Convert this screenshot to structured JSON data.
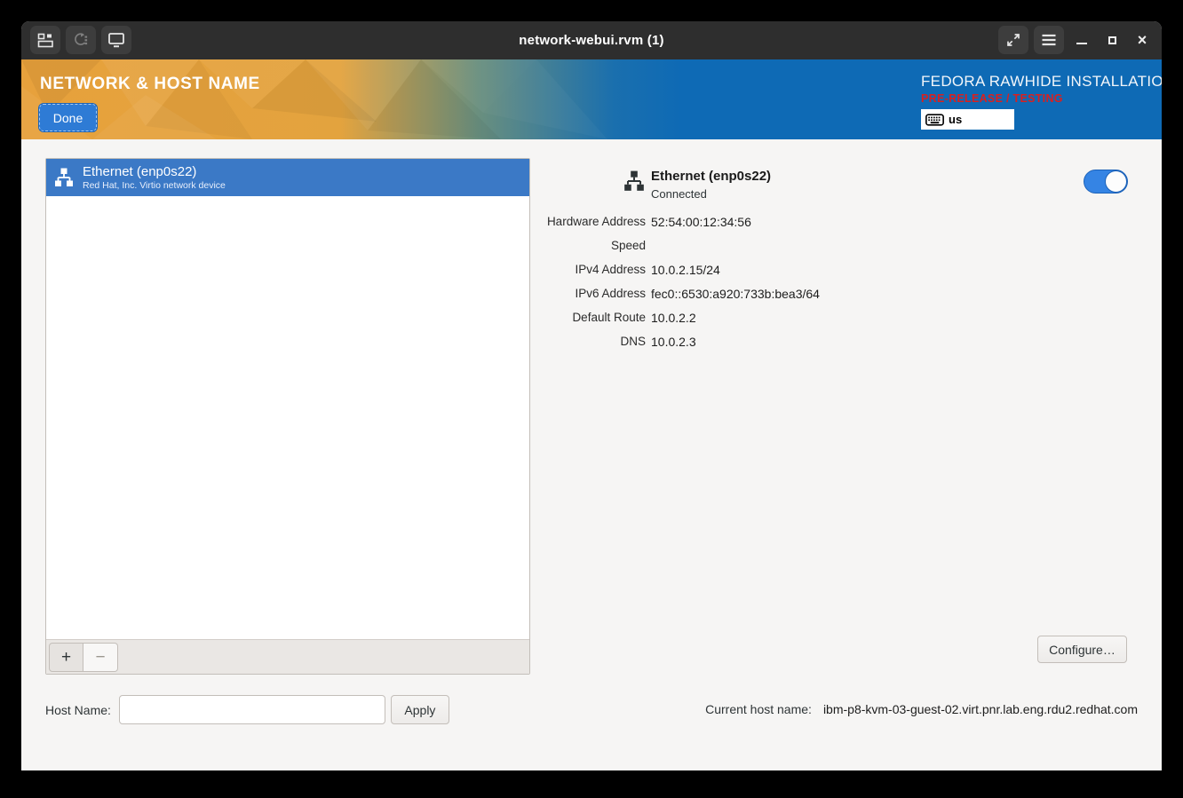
{
  "titlebar": {
    "title": "network-webui.rvm (1)"
  },
  "header": {
    "title": "NETWORK & HOST NAME",
    "done_label": "Done",
    "product": "FEDORA RAWHIDE INSTALLATION",
    "prerelease": "PRE-RELEASE / TESTING",
    "keyboard_layout": "us"
  },
  "device_list": {
    "items": [
      {
        "title": "Ethernet (enp0s22)",
        "subtitle": "Red Hat, Inc. Virtio network device",
        "selected": true
      }
    ],
    "add_label": "+",
    "remove_label": "−"
  },
  "hostname": {
    "label": "Host Name:",
    "value": "",
    "apply_label": "Apply",
    "current_label": "Current host name:",
    "current_value": "ibm-p8-kvm-03-guest-02.virt.pnr.lab.eng.rdu2.redhat.com"
  },
  "details": {
    "title": "Ethernet (enp0s22)",
    "status": "Connected",
    "toggle_state": "on",
    "rows": [
      {
        "label": "Hardware Address",
        "value": "52:54:00:12:34:56"
      },
      {
        "label": "Speed",
        "value": ""
      },
      {
        "label": "IPv4 Address",
        "value": "10.0.2.15/24"
      },
      {
        "label": "IPv6 Address",
        "value": "fec0::6530:a920:733b:bea3/64"
      },
      {
        "label": "Default Route",
        "value": "10.0.2.2"
      },
      {
        "label": "DNS",
        "value": "10.0.2.3"
      }
    ],
    "configure_label": "Configure…"
  },
  "icons": {
    "close-icon": "×",
    "minimize-icon": "–",
    "maximize-icon": "□",
    "menu-icon": "≡",
    "fullscreen-icon": "diagonal-arrows",
    "network-icon": "workgroup-tree",
    "keyboard-icon": "keyboard"
  },
  "colors": {
    "titlebar_bg": "#2e2e2e",
    "header_orange": "#e7a13c",
    "header_blue": "#0e6ab5",
    "prerelease_red": "#d9201f",
    "selected_row_blue": "#3b79c6",
    "done_button_blue": "#2e7bd5",
    "toggle_blue": "#3584e4",
    "content_bg": "#f6f5f4"
  }
}
